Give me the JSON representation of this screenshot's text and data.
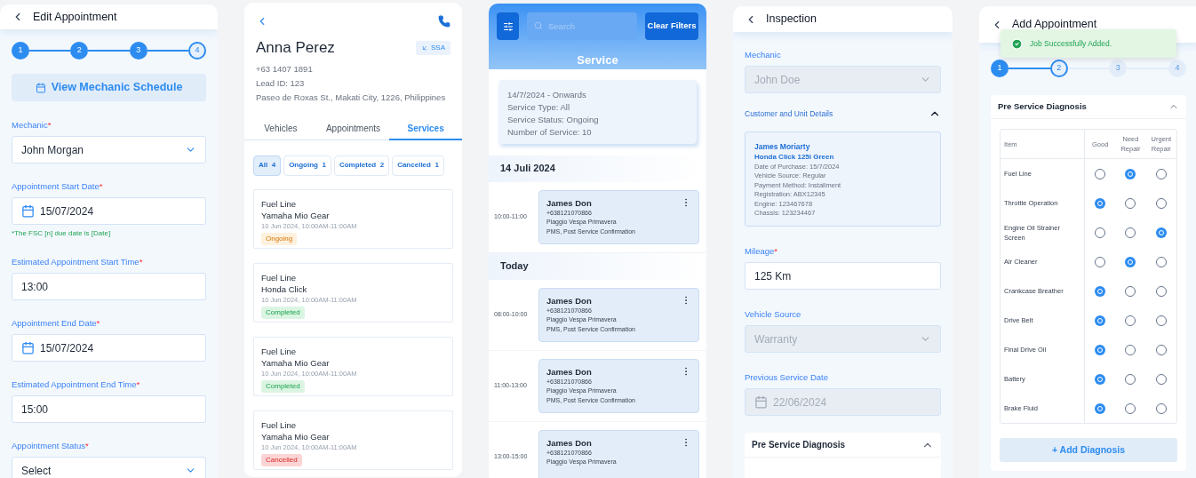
{
  "edit_appointment": {
    "title": "Edit Appointment",
    "steps": [
      {
        "label": "1",
        "completed": true,
        "current": false
      },
      {
        "label": "2",
        "completed": true,
        "current": false
      },
      {
        "label": "3",
        "completed": true,
        "current": false
      },
      {
        "label": "4",
        "completed": false,
        "current": true
      }
    ],
    "schedule_button": "View Mechanic Schedule",
    "fields": [
      {
        "kind": "select",
        "label": "Mechanic",
        "required_mark": "*",
        "value": "John Morgan"
      },
      {
        "kind": "date",
        "label": "Appointment Start Date",
        "required_mark": "*",
        "value": "15/07/2024",
        "note": "*The FSC [n] due date is [Date]"
      },
      {
        "kind": "text",
        "label": "Estimated Appointment Start Time",
        "required_mark": "*",
        "value": "13:00"
      },
      {
        "kind": "date",
        "label": "Appointment End Date",
        "required_mark": "*",
        "value": "15/07/2024"
      },
      {
        "kind": "text",
        "label": "Estimated Appointment End Time",
        "required_mark": "*",
        "value": "15:00"
      },
      {
        "kind": "select",
        "label": "Appointment Status",
        "required_mark": "*",
        "value": "Select"
      }
    ]
  },
  "customer": {
    "name": "Anna Perez",
    "badge": "SSA",
    "phone": "+63 1407 1891",
    "lead_id": "Lead ID: 123",
    "address": "Paseo de Roxas St., Makati City, 1226, Philippines",
    "tabs": [
      {
        "label": "Vehicles",
        "selected": false
      },
      {
        "label": "Appointments",
        "selected": false
      },
      {
        "label": "Services",
        "selected": true
      }
    ],
    "filters": [
      {
        "label": "All",
        "count": "4",
        "selected": true
      },
      {
        "label": "Ongoing",
        "count": "1",
        "selected": false
      },
      {
        "label": "Completed",
        "count": "2",
        "selected": false
      },
      {
        "label": "Cancelled",
        "count": "1",
        "selected": false
      }
    ],
    "services": [
      {
        "title": "Fuel Line",
        "vehicle": "Yamaha Mio Gear",
        "time": "10 Jun 2024, 10:00AM-11:00AM",
        "status": "Ongoing",
        "kind": "ongoing"
      },
      {
        "title": "Fuel Line",
        "vehicle": "Honda Click",
        "time": "10 Jun 2024, 10:00AM-11:00AM",
        "status": "Completed",
        "kind": "completed"
      },
      {
        "title": "Fuel Line",
        "vehicle": "Yamaha Mio Gear",
        "time": "10 Jun 2024, 10:00AM-11:00AM",
        "status": "Completed",
        "kind": "completed"
      },
      {
        "title": "Fuel Line",
        "vehicle": "Yamaha Mio Gear",
        "time": "10 Jun 2024, 10:00AM-11:00AM",
        "status": "Cancelled",
        "kind": "cancelled"
      }
    ]
  },
  "service": {
    "search": {
      "placeholder": "Search"
    },
    "clear_button": "Clear Filters",
    "title": "Service",
    "summary": [
      "14/7/2024 - Onwards",
      "Service Type: All",
      "Service Status: Ongoing",
      "Number of Service: 10"
    ],
    "groups": [
      {
        "heading": "14 Juli 2024",
        "items": [
          {
            "time": "10:00-11:00",
            "name": "James Don",
            "phone": "+638121070866",
            "vehicle": "Piaggio Vespa Primavera",
            "services": "PMS, Post Service Confirmation"
          }
        ]
      },
      {
        "heading": "Today",
        "items": [
          {
            "time": "08:00-10:00",
            "name": "James Don",
            "phone": "+638121070866",
            "vehicle": "Piaggio Vespa Primavera",
            "services": "PMS, Post Service Confirmation"
          },
          {
            "time": "11:00-13:00",
            "name": "James Don",
            "phone": "+638121070866",
            "vehicle": "Piaggio Vespa Primavera",
            "services": "PMS, Post Service Confirmation"
          },
          {
            "time": "13:00-15:00",
            "name": "James Don",
            "phone": "+638121070866",
            "vehicle": "Piaggio Vespa Primavera"
          }
        ]
      }
    ]
  },
  "inspection": {
    "title": "Inspection",
    "mechanic": {
      "kind": "select",
      "label": "Mechanic",
      "value": "John Doe",
      "disabled": true
    },
    "details": {
      "heading": "Customer and Unit Details",
      "expanded": true,
      "customer": "James Moriarty",
      "unit": "Honda Click 125i Green",
      "lines": [
        "Date of Purchase: 15/7/2024",
        "Vehicle Source: Regular",
        "Payment Method: Installment",
        "Registration: ABX12345",
        "Engine: 123467678",
        "Chassis: 123234467"
      ]
    },
    "fields": [
      {
        "kind": "text",
        "label": "Mileage",
        "required_mark": "*",
        "value": "125 Km",
        "disabled": false
      },
      {
        "kind": "select",
        "label": "Vehicle Source",
        "value": "Warranty",
        "disabled": true
      },
      {
        "kind": "date",
        "label": "Previous Service Date",
        "value": "22/06/2024",
        "disabled": true
      }
    ],
    "diagnosis": {
      "title": "Pre Service Diagnosis",
      "expanded": true
    }
  },
  "add_appointment": {
    "title": "Add Appointment",
    "toast": "Job Successfully Added.",
    "steps": [
      {
        "label": "1",
        "completed": true,
        "current": false
      },
      {
        "label": "2",
        "completed": false,
        "current": true
      },
      {
        "label": "3",
        "completed": false,
        "current": false
      },
      {
        "label": "4",
        "completed": false,
        "current": false
      }
    ],
    "diagnosis": {
      "title": "Pre Service Diagnosis",
      "expanded": true,
      "columns": [
        "Item",
        "Good",
        "Need Repair",
        "Urgent Repair"
      ],
      "rows": [
        {
          "item": "Fuel Line",
          "options": [
            {
              "selected": false
            },
            {
              "selected": true
            },
            {
              "selected": false
            }
          ]
        },
        {
          "item": "Throttle Operation",
          "options": [
            {
              "selected": true
            },
            {
              "selected": false
            },
            {
              "selected": false
            }
          ]
        },
        {
          "item": "Engine Oil Strainer Screen",
          "options": [
            {
              "selected": false
            },
            {
              "selected": false
            },
            {
              "selected": true
            }
          ]
        },
        {
          "item": "Air Cleaner",
          "options": [
            {
              "selected": false
            },
            {
              "selected": true
            },
            {
              "selected": false
            }
          ]
        },
        {
          "item": "Crankcase Breather",
          "options": [
            {
              "selected": true
            },
            {
              "selected": false
            },
            {
              "selected": false
            }
          ]
        },
        {
          "item": "Drive Belt",
          "options": [
            {
              "selected": true
            },
            {
              "selected": false
            },
            {
              "selected": false
            }
          ]
        },
        {
          "item": "Final Drive Oil",
          "options": [
            {
              "selected": true
            },
            {
              "selected": false
            },
            {
              "selected": false
            }
          ]
        },
        {
          "item": "Battery",
          "options": [
            {
              "selected": true
            },
            {
              "selected": false
            },
            {
              "selected": false
            }
          ]
        },
        {
          "item": "Brake Fluid",
          "options": [
            {
              "selected": true
            },
            {
              "selected": false
            },
            {
              "selected": false
            }
          ]
        }
      ]
    },
    "add_button": "+ Add Diagnosis"
  }
}
